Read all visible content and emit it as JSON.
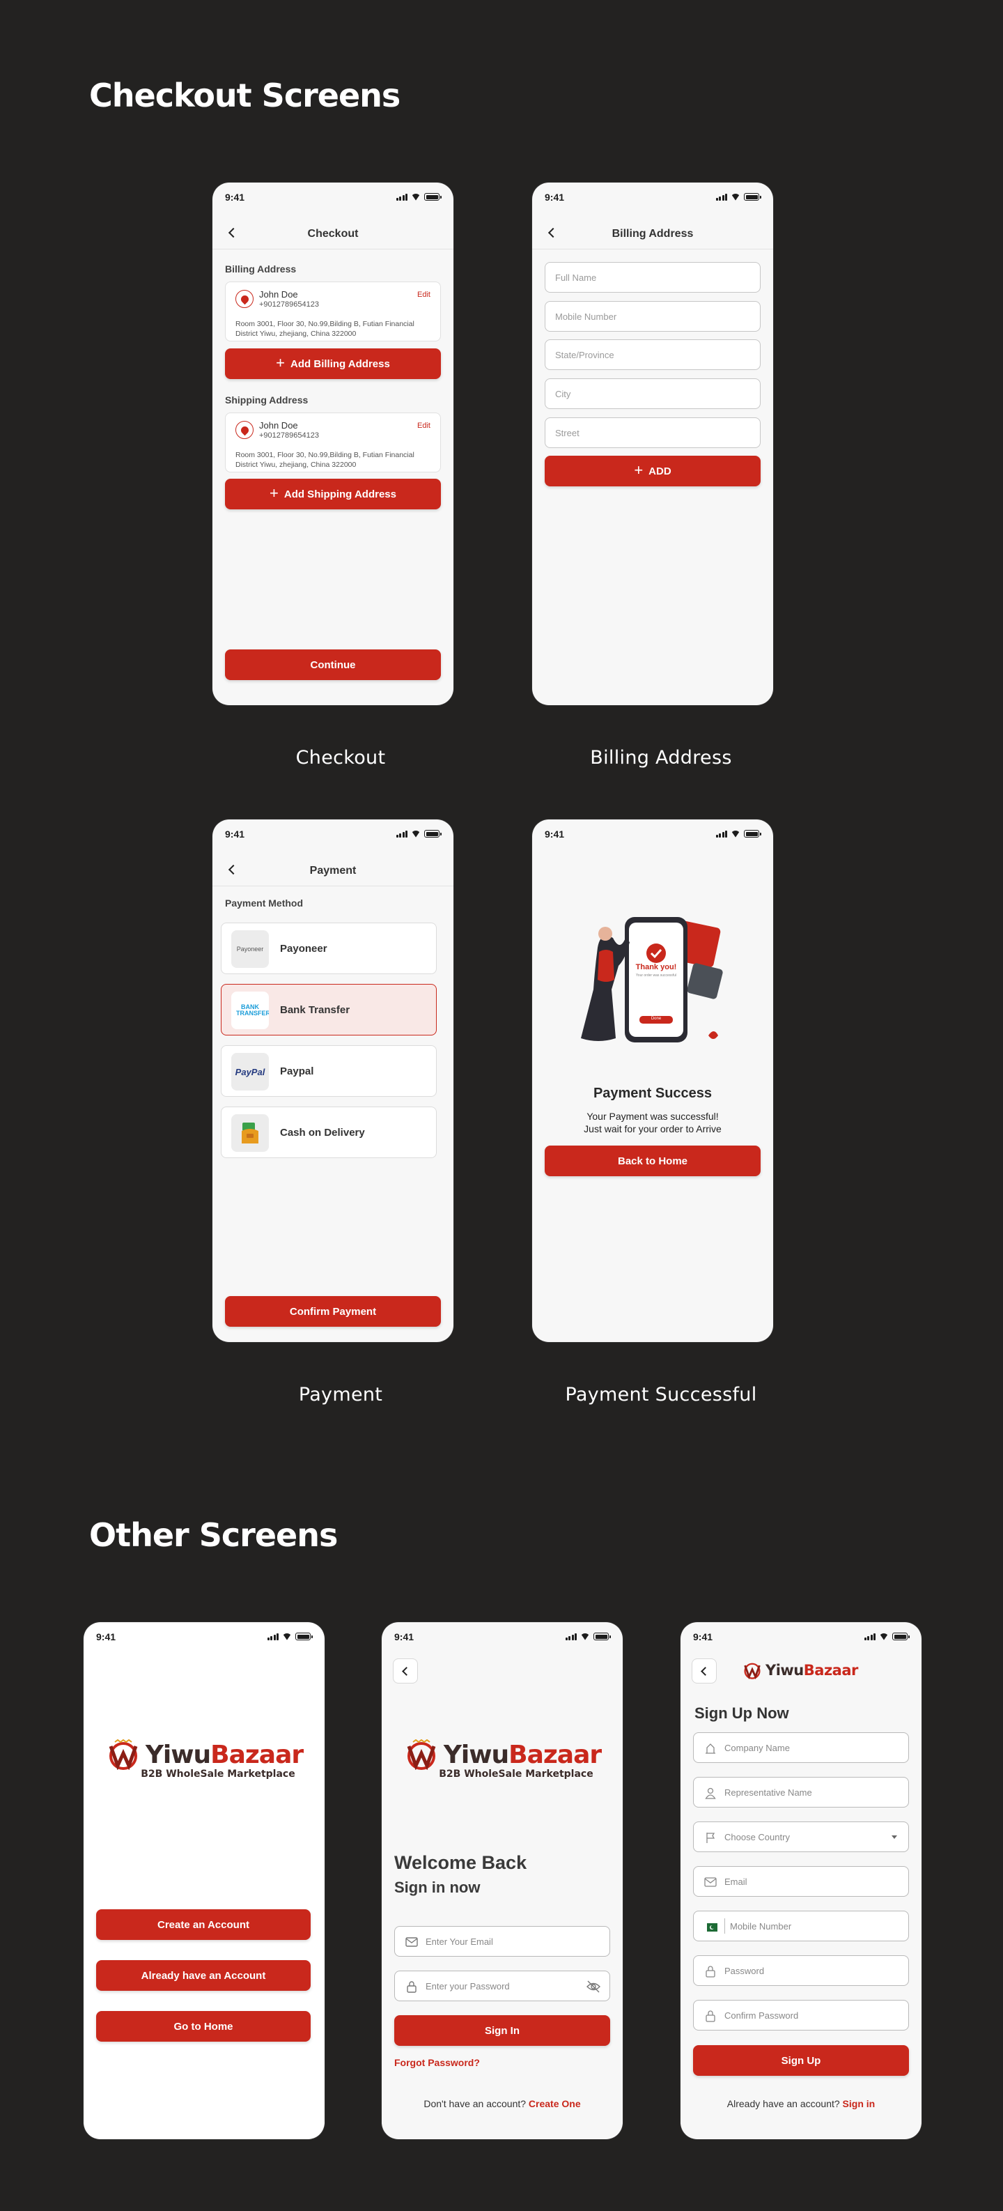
{
  "colors": {
    "background": "#232221",
    "accent": "#c9281c",
    "screen": "#f7f7f7"
  },
  "status_time": "9:41",
  "sections": {
    "checkout": "Checkout Screens",
    "other": "Other Screens"
  },
  "captions": {
    "checkout": "Checkout",
    "billing": "Billing Address",
    "payment": "Payment",
    "success": "Payment Successful"
  },
  "checkout": {
    "title": "Checkout",
    "billing_label": "Billing Address",
    "shipping_label": "Shipping Address",
    "billing": {
      "name": "John Doe",
      "phone": "+9012789654123",
      "edit": "Edit",
      "address": "Room 3001, Floor 30, No.99,Bilding B, Futian Financial District Yiwu, zhejiang, China 322000"
    },
    "shipping": {
      "name": "John Doe",
      "phone": "+9012789654123",
      "edit": "Edit",
      "address": "Room 3001, Floor 30, No.99,Bilding B, Futian Financial District Yiwu, zhejiang, China 322000"
    },
    "add_billing": "Add Billing Address",
    "add_shipping": "Add Shipping Address",
    "continue": "Continue"
  },
  "billing": {
    "title": "Billing Address",
    "placeholders": [
      "Full Name",
      "Mobile Number",
      "State/Province",
      "City",
      "Street"
    ],
    "add": "ADD"
  },
  "payment": {
    "title": "Payment",
    "method_label": "Payment Method",
    "methods": [
      {
        "name": "Payoneer",
        "logo": "Payoneer"
      },
      {
        "name": "Bank Transfer",
        "logo": "BANK TRANSFER",
        "selected": true
      },
      {
        "name": "Paypal",
        "logo": "PayPal"
      },
      {
        "name": "Cash on Delivery",
        "logo": "cash-icon"
      }
    ],
    "confirm": "Confirm Payment"
  },
  "success": {
    "illustration_text": "Thank you!",
    "illustration_sub": "Your order was successful",
    "illustration_btn": "Done",
    "title": "Payment Success",
    "line1": "Your Payment was successful!",
    "line2": "Just wait for your order to Arrive",
    "button": "Back to Home"
  },
  "brand": {
    "name_a": "Yiwu",
    "name_b": "Bazaar",
    "tagline": "B2B WholeSale Marketplace"
  },
  "welcome": {
    "create": "Create an Account",
    "have": "Already have an Account",
    "home": "Go to Home"
  },
  "signin": {
    "title": "Welcome Back",
    "subtitle": "Sign in now",
    "email_ph": "Enter Your Email",
    "password_ph": "Enter your Password",
    "button": "Sign In",
    "forgot": "Forgot Password?",
    "no_account": "Don't have an account?",
    "create": "Create One"
  },
  "signup": {
    "title": "Sign Up Now",
    "company_ph": "Company Name",
    "rep_ph": "Representative Name",
    "country_ph": "Choose Country",
    "email_ph": "Email",
    "mobile_ph": "Mobile Number",
    "password_ph": "Password",
    "confirm_ph": "Confirm Password",
    "button": "Sign Up",
    "have_account": "Already have an account?",
    "signin": "Sign in"
  }
}
